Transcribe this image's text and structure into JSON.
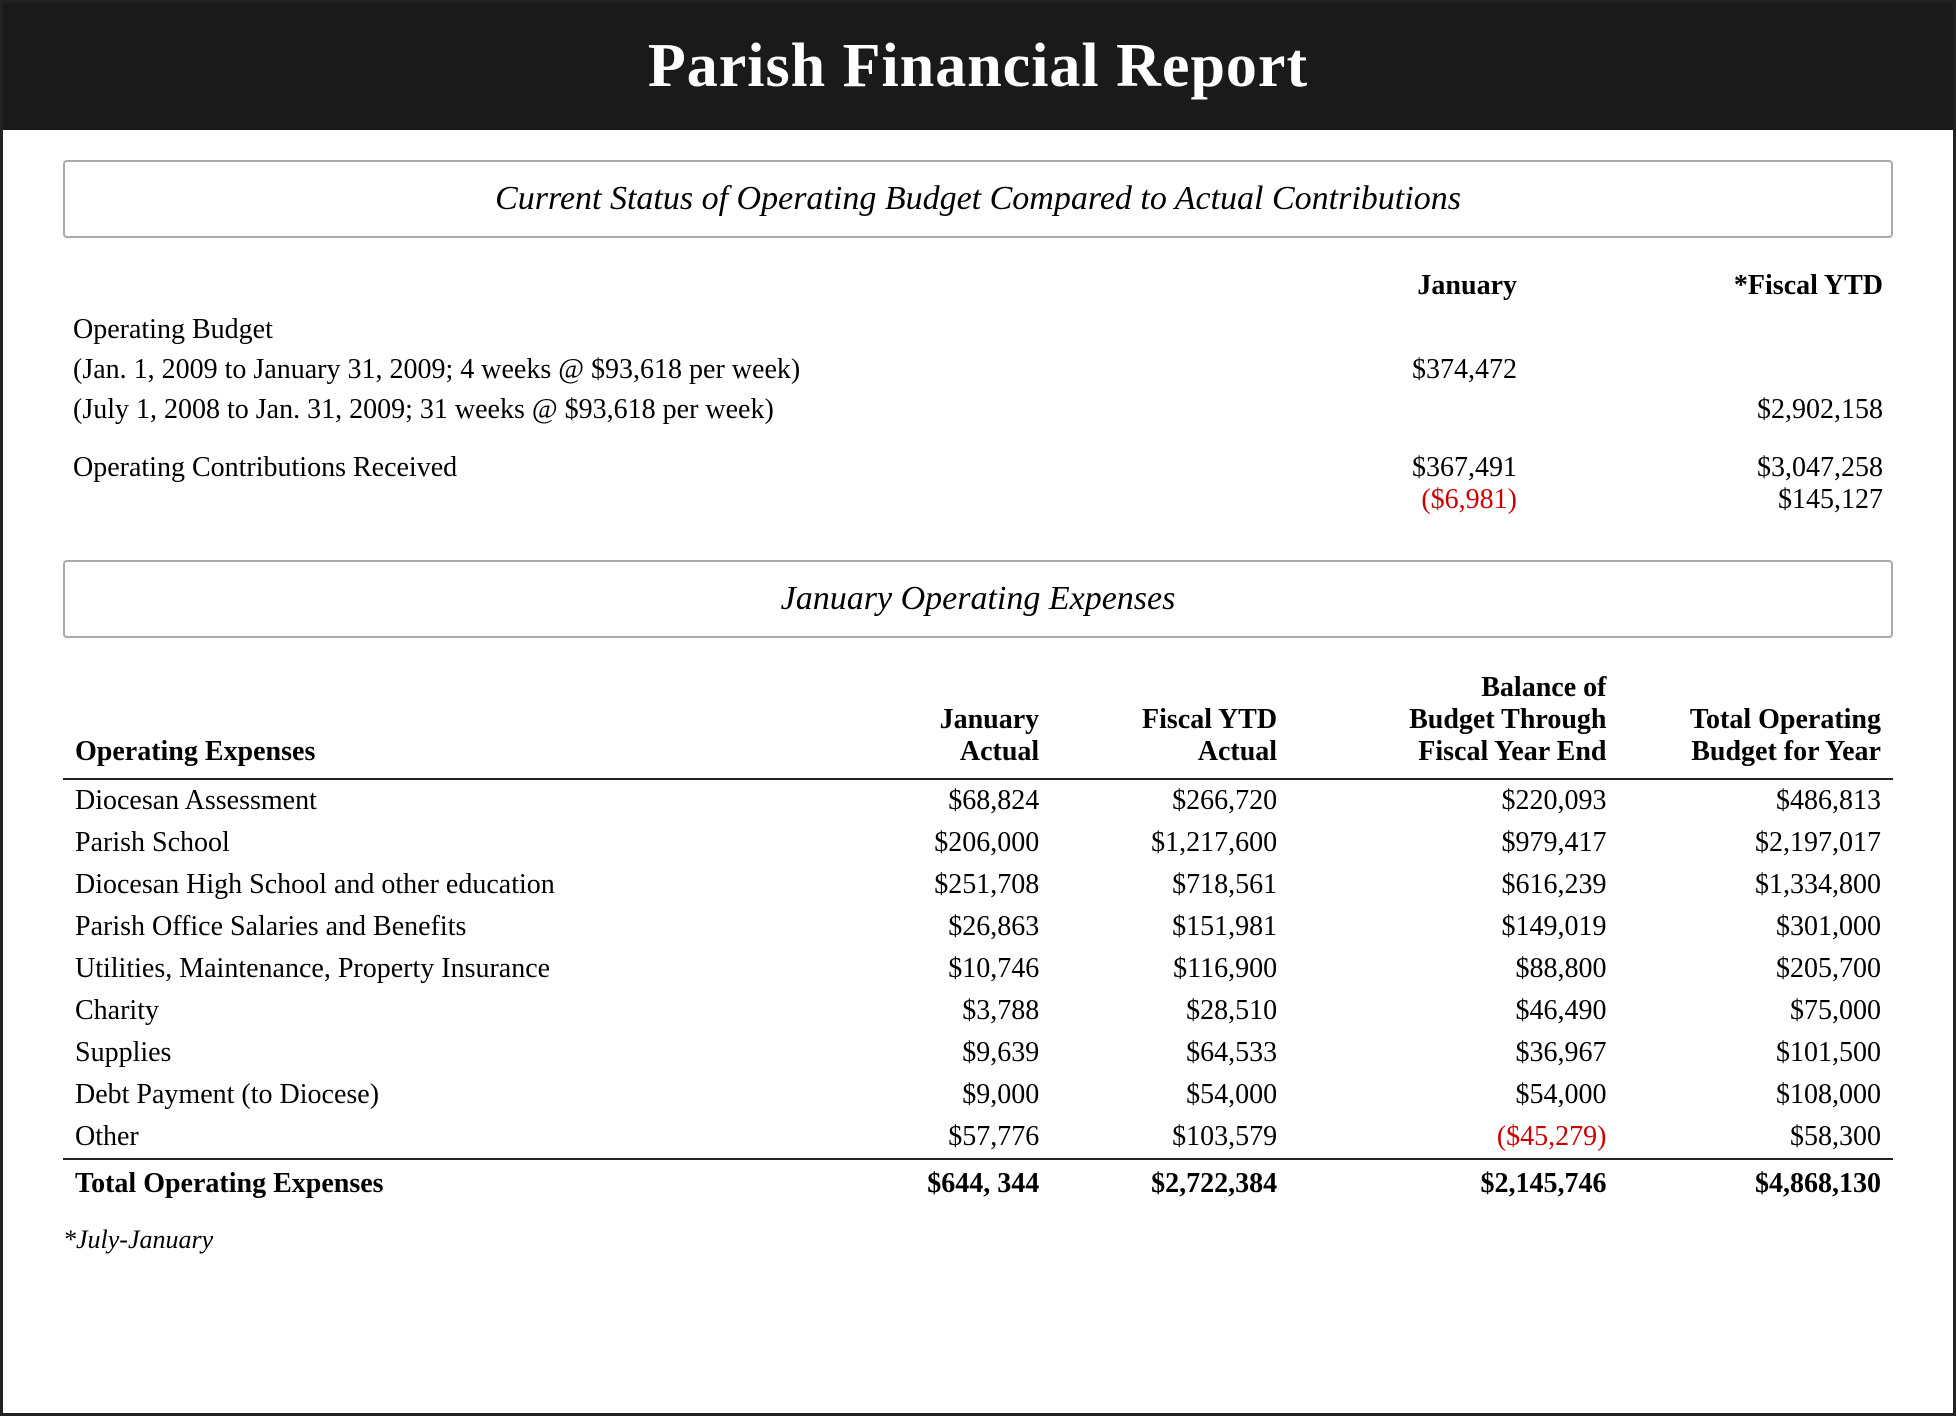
{
  "header": {
    "title": "Parish Financial Report"
  },
  "section1": {
    "title": "Current Status of Operating Budget Compared to Actual Contributions",
    "col_jan": "January",
    "col_ytd": "*Fiscal YTD",
    "operating_budget_label": "Operating Budget",
    "ob_line1": "(Jan. 1, 2009 to January 31, 2009; 4 weeks @ $93,618 per week)",
    "ob_line1_jan": "$374,472",
    "ob_line2": "(July 1, 2008 to Jan. 31, 2009; 31 weeks @ $93,618 per week)",
    "ob_line2_ytd": "$2,902,158",
    "contrib_label": "Operating Contributions Received",
    "contrib_jan": "$367,491",
    "contrib_jan_diff": "($6,981)",
    "contrib_ytd": "$3,047,258",
    "contrib_ytd_diff": "$145,127"
  },
  "section2": {
    "title": "January Operating Expenses",
    "col1_header": "January\nActual",
    "col2_header": "Fiscal YTD\nActual",
    "col3_header": "Balance of\nBudget Through\nFiscal Year End",
    "col4_header": "Total Operating\nBudget for Year",
    "row_label": "Operating Expenses",
    "rows": [
      {
        "label": "Diocesan Assessment",
        "jan": "$68,824",
        "ytd": "$266,720",
        "balance": "$220,093",
        "total": "$486,813"
      },
      {
        "label": "Parish School",
        "jan": "$206,000",
        "ytd": "$1,217,600",
        "balance": "$979,417",
        "total": "$2,197,017"
      },
      {
        "label": "Diocesan High School and other education",
        "jan": "$251,708",
        "ytd": "$718,561",
        "balance": "$616,239",
        "total": "$1,334,800"
      },
      {
        "label": "Parish Office Salaries and Benefits",
        "jan": "$26,863",
        "ytd": "$151,981",
        "balance": "$149,019",
        "total": "$301,000"
      },
      {
        "label": "Utilities, Maintenance, Property Insurance",
        "jan": "$10,746",
        "ytd": "$116,900",
        "balance": "$88,800",
        "total": "$205,700"
      },
      {
        "label": "Charity",
        "jan": "$3,788",
        "ytd": "$28,510",
        "balance": "$46,490",
        "total": "$75,000"
      },
      {
        "label": "Supplies",
        "jan": "$9,639",
        "ytd": "$64,533",
        "balance": "$36,967",
        "total": "$101,500"
      },
      {
        "label": "Debt Payment (to Diocese)",
        "jan": "$9,000",
        "ytd": "$54,000",
        "balance": "$54,000",
        "total": "$108,000"
      },
      {
        "label": "Other",
        "jan": "$57,776",
        "ytd": "$103,579",
        "balance": "($45,279)",
        "total": "$58,300",
        "balance_red": true
      }
    ],
    "total_row": {
      "label": "Total Operating Expenses",
      "jan": "$644, 344",
      "ytd": "$2,722,384",
      "balance": "$2,145,746",
      "total": "$4,868,130"
    },
    "footnote": "*July-January"
  }
}
